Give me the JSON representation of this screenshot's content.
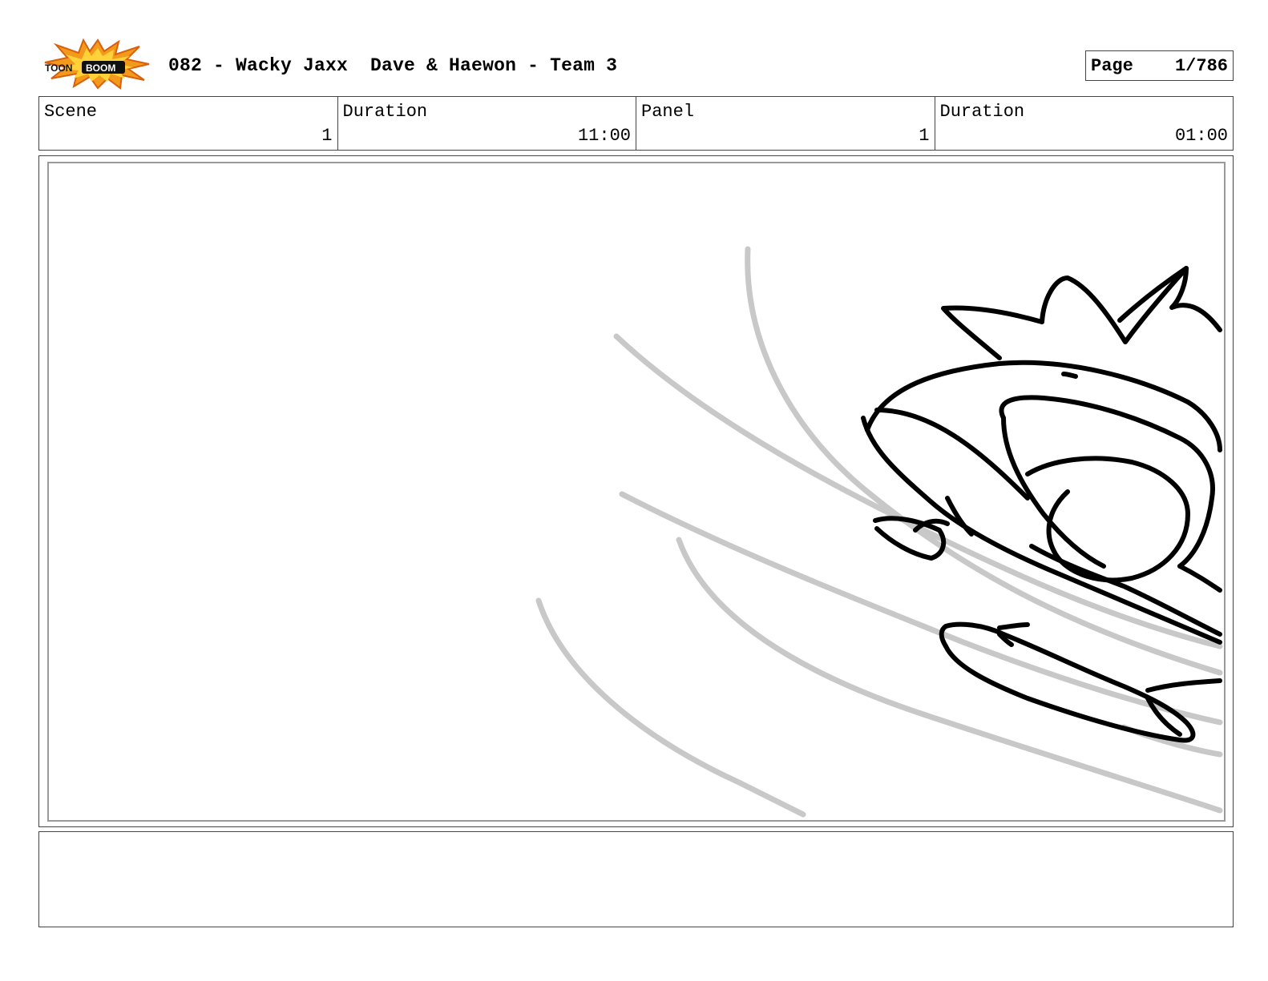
{
  "header": {
    "logo_icon": "toon-boom-logo",
    "logo_text_left": "TOON",
    "logo_text_right": "BOOM",
    "title": "082 - Wacky Jaxx  Dave & Haewon - Team 3",
    "page_label": "Page",
    "page_value": "1/786"
  },
  "info": {
    "scene_label": "Scene",
    "scene_value": "1",
    "scene_duration_label": "Duration",
    "scene_duration_value": "11:00",
    "panel_label": "Panel",
    "panel_value": "1",
    "panel_duration_label": "Duration",
    "panel_duration_value": "01:00"
  },
  "panel": {
    "drawing": "storyboard-sketch-character-swooping",
    "motion_line_color": "#c8c8c8",
    "ink_color": "#000000"
  },
  "notes": {
    "text": ""
  }
}
